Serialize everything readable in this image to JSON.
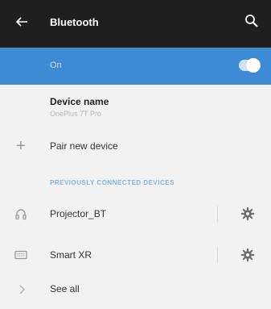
{
  "app_bar": {
    "title": "Bluetooth",
    "back_icon": "arrow-left-icon",
    "search_icon": "search-icon"
  },
  "toggle": {
    "label": "On",
    "state": "on",
    "accent": "#3d8bd4"
  },
  "device_name": {
    "label": "Device name",
    "value": "OnePlus 7T Pro"
  },
  "pair": {
    "label": "Pair new device",
    "icon": "plus-icon"
  },
  "section": {
    "header": "PREVIOUSLY CONNECTED DEVICES"
  },
  "devices": [
    {
      "name": "Projector_BT",
      "icon": "headphones-icon",
      "settings_icon": "gear-icon"
    },
    {
      "name": "Smart XR",
      "icon": "keyboard-icon",
      "settings_icon": "gear-icon"
    }
  ],
  "see_all": {
    "label": "See all",
    "icon": "chevron-right-icon"
  }
}
